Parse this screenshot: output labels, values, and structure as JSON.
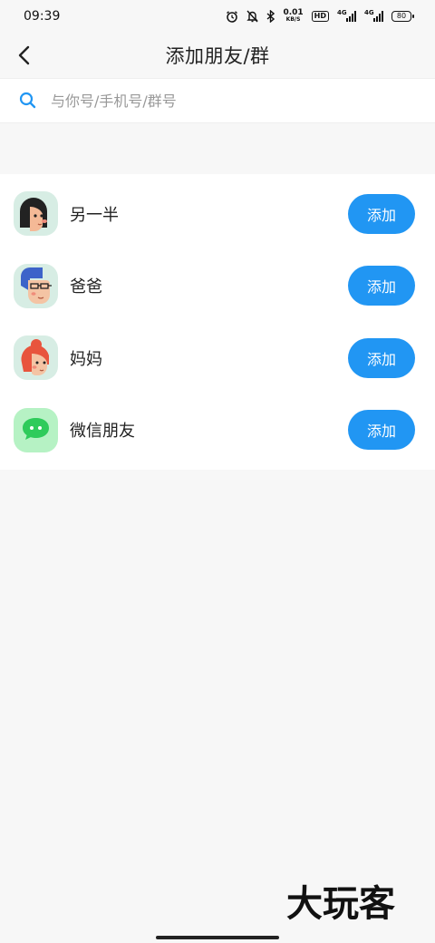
{
  "status_bar": {
    "time": "09:39",
    "net_speed_value": "0.01",
    "net_speed_unit": "KB/S",
    "hd_label": "HD",
    "signal_1_label": "4G",
    "signal_2_label": "4G",
    "battery_level": "80",
    "icons": [
      "alarm-icon",
      "mute-icon",
      "bluetooth-icon",
      "hd-icon",
      "signal-icon",
      "signal-icon",
      "battery-icon"
    ]
  },
  "nav": {
    "title": "添加朋友/群",
    "back_icon": "back-arrow-icon"
  },
  "search": {
    "placeholder": "与你号/手机号/群号",
    "value": "",
    "icon": "search-icon",
    "accent": "#2196f3"
  },
  "contacts": [
    {
      "label": "另一半",
      "action": "添加",
      "avatar": "wife-avatar-icon"
    },
    {
      "label": "爸爸",
      "action": "添加",
      "avatar": "dad-avatar-icon"
    },
    {
      "label": "妈妈",
      "action": "添加",
      "avatar": "mom-avatar-icon"
    },
    {
      "label": "微信朋友",
      "action": "添加",
      "avatar": "wechat-icon"
    }
  ],
  "watermark": {
    "text": "大玩客"
  },
  "colors": {
    "background": "#f7f7f7",
    "button": "#2196f3",
    "avatar_bg": "#d7ede4",
    "wechat_bg": "#b6f2c4",
    "wechat_green": "#2fcb5b"
  }
}
